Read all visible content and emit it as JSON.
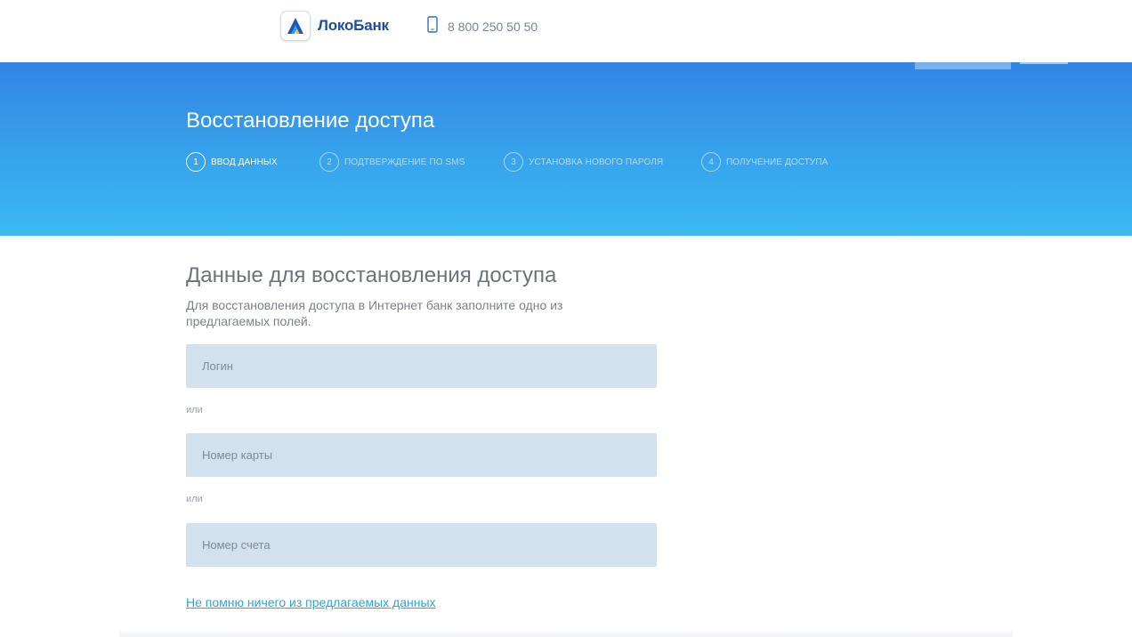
{
  "header": {
    "logo_text": "ЛокоБанк",
    "phone": "8 800 250 50 50",
    "icons": {
      "logo": "lokobank-logo-icon",
      "phone": "mobile-phone-icon"
    },
    "brand_color": "#1f4d9c"
  },
  "hero": {
    "title": "Восстановление доступа",
    "steps": [
      {
        "number": "1",
        "label": "ввод данных",
        "active": true
      },
      {
        "number": "2",
        "label": "подтверждение по sms",
        "active": false
      },
      {
        "number": "3",
        "label": "установка нового пароля",
        "active": false
      },
      {
        "number": "4",
        "label": "получение доступа",
        "active": false
      }
    ],
    "gradient_top": "#3385e4",
    "gradient_bottom": "#3cbaf3"
  },
  "form": {
    "title": "Данные для восстановления доступа",
    "description": "Для восстановления доступа в Интернет банк заполните одно из предлагаемых полей.",
    "login_placeholder": "Логин",
    "login_value": "",
    "card_placeholder": "Номер карты",
    "card_value": "",
    "account_placeholder": "Номер счета",
    "account_value": "",
    "or_label": "или",
    "forgot_link": "Не помню ничего из предлагаемых данных",
    "field_color": "#d1e1ed",
    "link_color": "#2aa7dd"
  }
}
